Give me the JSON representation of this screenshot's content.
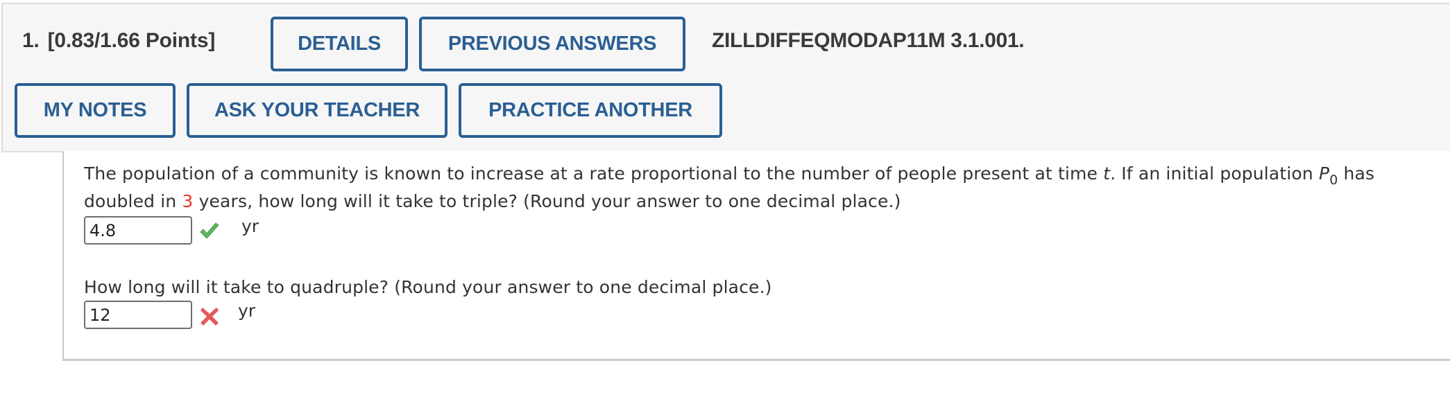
{
  "question": {
    "number": "1.",
    "points": "[0.83/1.66 Points]",
    "problem_id": "ZILLDIFFEQMODAP11M 3.1.001."
  },
  "buttons": {
    "details": "DETAILS",
    "previous_answers": "PREVIOUS ANSWERS",
    "my_notes": "MY NOTES",
    "ask_your_teacher": "ASK YOUR TEACHER",
    "practice_another": "PRACTICE ANOTHER"
  },
  "problem": {
    "line1_a": "The population of a community is known to increase at a rate proportional to the number of people present at time ",
    "var_t": "t",
    "line1_b": ". If an initial population ",
    "var_P": "P",
    "sub_0": "0",
    "line1_c": " has",
    "line2_a": "doubled in ",
    "doubling_years": "3",
    "line2_b": " years, how long will it take to triple? (Round your answer to one decimal place.)",
    "part2": "How long will it take to quadruple? (Round your answer to one decimal place.)"
  },
  "answers": [
    {
      "value": "4.8",
      "unit": "yr",
      "status": "correct",
      "status_color": "#5cb85c"
    },
    {
      "value": "12",
      "unit": "yr",
      "status": "incorrect",
      "status_color": "#e04848"
    }
  ],
  "colors": {
    "accent": "#2b5f94",
    "highlight": "#e5362a",
    "header_bg": "#f6f6f6"
  }
}
